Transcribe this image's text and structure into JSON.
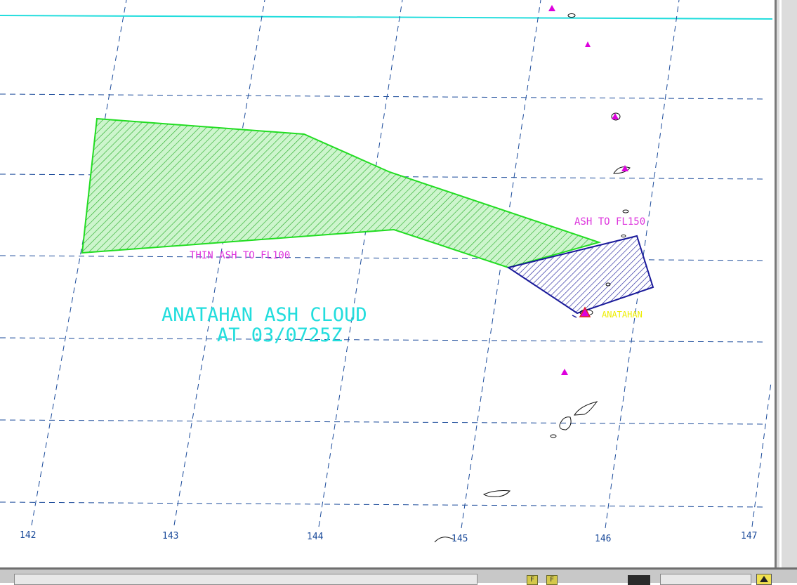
{
  "map": {
    "title_line1": "ANATAHAN ASH CLOUD",
    "title_line2": "AT 03/0725Z",
    "label_thin_ash": "THIN ASH TO FL100",
    "label_ash": "ASH TO FL150",
    "label_volcano": "ANATAHAN",
    "longitudes": [
      "142",
      "143",
      "144",
      "145",
      "146",
      "147"
    ],
    "colors": {
      "thin_ash": "#22dd22",
      "thick_ash": "#1a1a9a",
      "grid": "#1a4a9a",
      "title": "#22dddd",
      "labels": "#dd33dd",
      "volcano_label": "#eeee00",
      "volcano_markers": "#dd00dd",
      "coastline": "#111111",
      "lat_line": "#22dddd"
    }
  },
  "statusbar": {
    "btn1": "F",
    "btn2": "F"
  }
}
